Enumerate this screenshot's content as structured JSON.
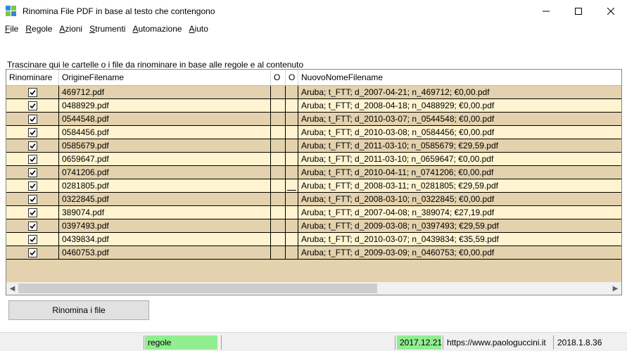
{
  "window": {
    "title": "Rinomina File PDF in base al testo che contengono",
    "minimize_glyph": "—",
    "maximize_glyph": "☐",
    "close_glyph": "✕"
  },
  "menu": [
    {
      "acc": "F",
      "rest": "ile"
    },
    {
      "acc": "R",
      "rest": "egole"
    },
    {
      "acc": "A",
      "rest": "zioni"
    },
    {
      "acc": "S",
      "rest": "trumenti"
    },
    {
      "acc": "A",
      "rest": "utomazione"
    },
    {
      "acc": "A",
      "rest": "iuto"
    }
  ],
  "drop_label": "Trascinare qui le cartelle o i file da rinominare in base alle regole e al contenuto",
  "grid": {
    "columns": [
      "Rinominare",
      "OrigineFilename",
      "O",
      "O",
      "NuovoNomeFilename"
    ],
    "rows": [
      {
        "checked": true,
        "origin": "469712.pdf",
        "new": "Aruba; t_FTT; d_2007-04-21; n_469712; €0,00.pdf",
        "mark": false
      },
      {
        "checked": true,
        "origin": "0488929.pdf",
        "new": "Aruba; t_FTT; d_2008-04-18; n_0488929; €0,00.pdf",
        "mark": false
      },
      {
        "checked": true,
        "origin": "0544548.pdf",
        "new": "Aruba; t_FTT; d_2010-03-07; n_0544548; €0,00.pdf",
        "mark": false
      },
      {
        "checked": true,
        "origin": "0584456.pdf",
        "new": "Aruba; t_FTT; d_2010-03-08; n_0584456; €0,00.pdf",
        "mark": false
      },
      {
        "checked": true,
        "origin": "0585679.pdf",
        "new": "Aruba; t_FTT; d_2011-03-10; n_0585679; €29,59.pdf",
        "mark": false
      },
      {
        "checked": true,
        "origin": "0659647.pdf",
        "new": "Aruba; t_FTT; d_2011-03-10; n_0659647; €0,00.pdf",
        "mark": false
      },
      {
        "checked": true,
        "origin": "0741206.pdf",
        "new": "Aruba; t_FTT; d_2010-04-11; n_0741206; €0,00.pdf",
        "mark": false
      },
      {
        "checked": true,
        "origin": "0281805.pdf",
        "new": "Aruba; t_FTT; d_2008-03-11; n_0281805; €29,59.pdf",
        "mark": true
      },
      {
        "checked": true,
        "origin": "0322845.pdf",
        "new": "Aruba; t_FTT; d_2008-03-10; n_0322845; €0,00.pdf",
        "mark": false
      },
      {
        "checked": true,
        "origin": "389074.pdf",
        "new": "Aruba; t_FTT; d_2007-04-08; n_389074; €27,19.pdf",
        "mark": false
      },
      {
        "checked": true,
        "origin": "0397493.pdf",
        "new": "Aruba; t_FTT; d_2009-03-08; n_0397493; €29,59.pdf",
        "mark": false
      },
      {
        "checked": true,
        "origin": "0439834.pdf",
        "new": "Aruba; t_FTT; d_2010-03-07; n_0439834; €35,59.pdf",
        "mark": false
      },
      {
        "checked": true,
        "origin": "0460753.pdf",
        "new": "Aruba; t_FTT; d_2009-03-09; n_0460753; €0,00.pdf",
        "mark": false
      }
    ]
  },
  "rename_button": "Rinomina i file",
  "status": {
    "rules": "regole",
    "date": "2017.12.21",
    "url": "https://www.paologuccini.it",
    "version": "2018.1.8.36"
  },
  "colors": {
    "row_dark": "#e3d2ad",
    "row_light": "#fff3d0",
    "status_green": "#90ee90"
  }
}
